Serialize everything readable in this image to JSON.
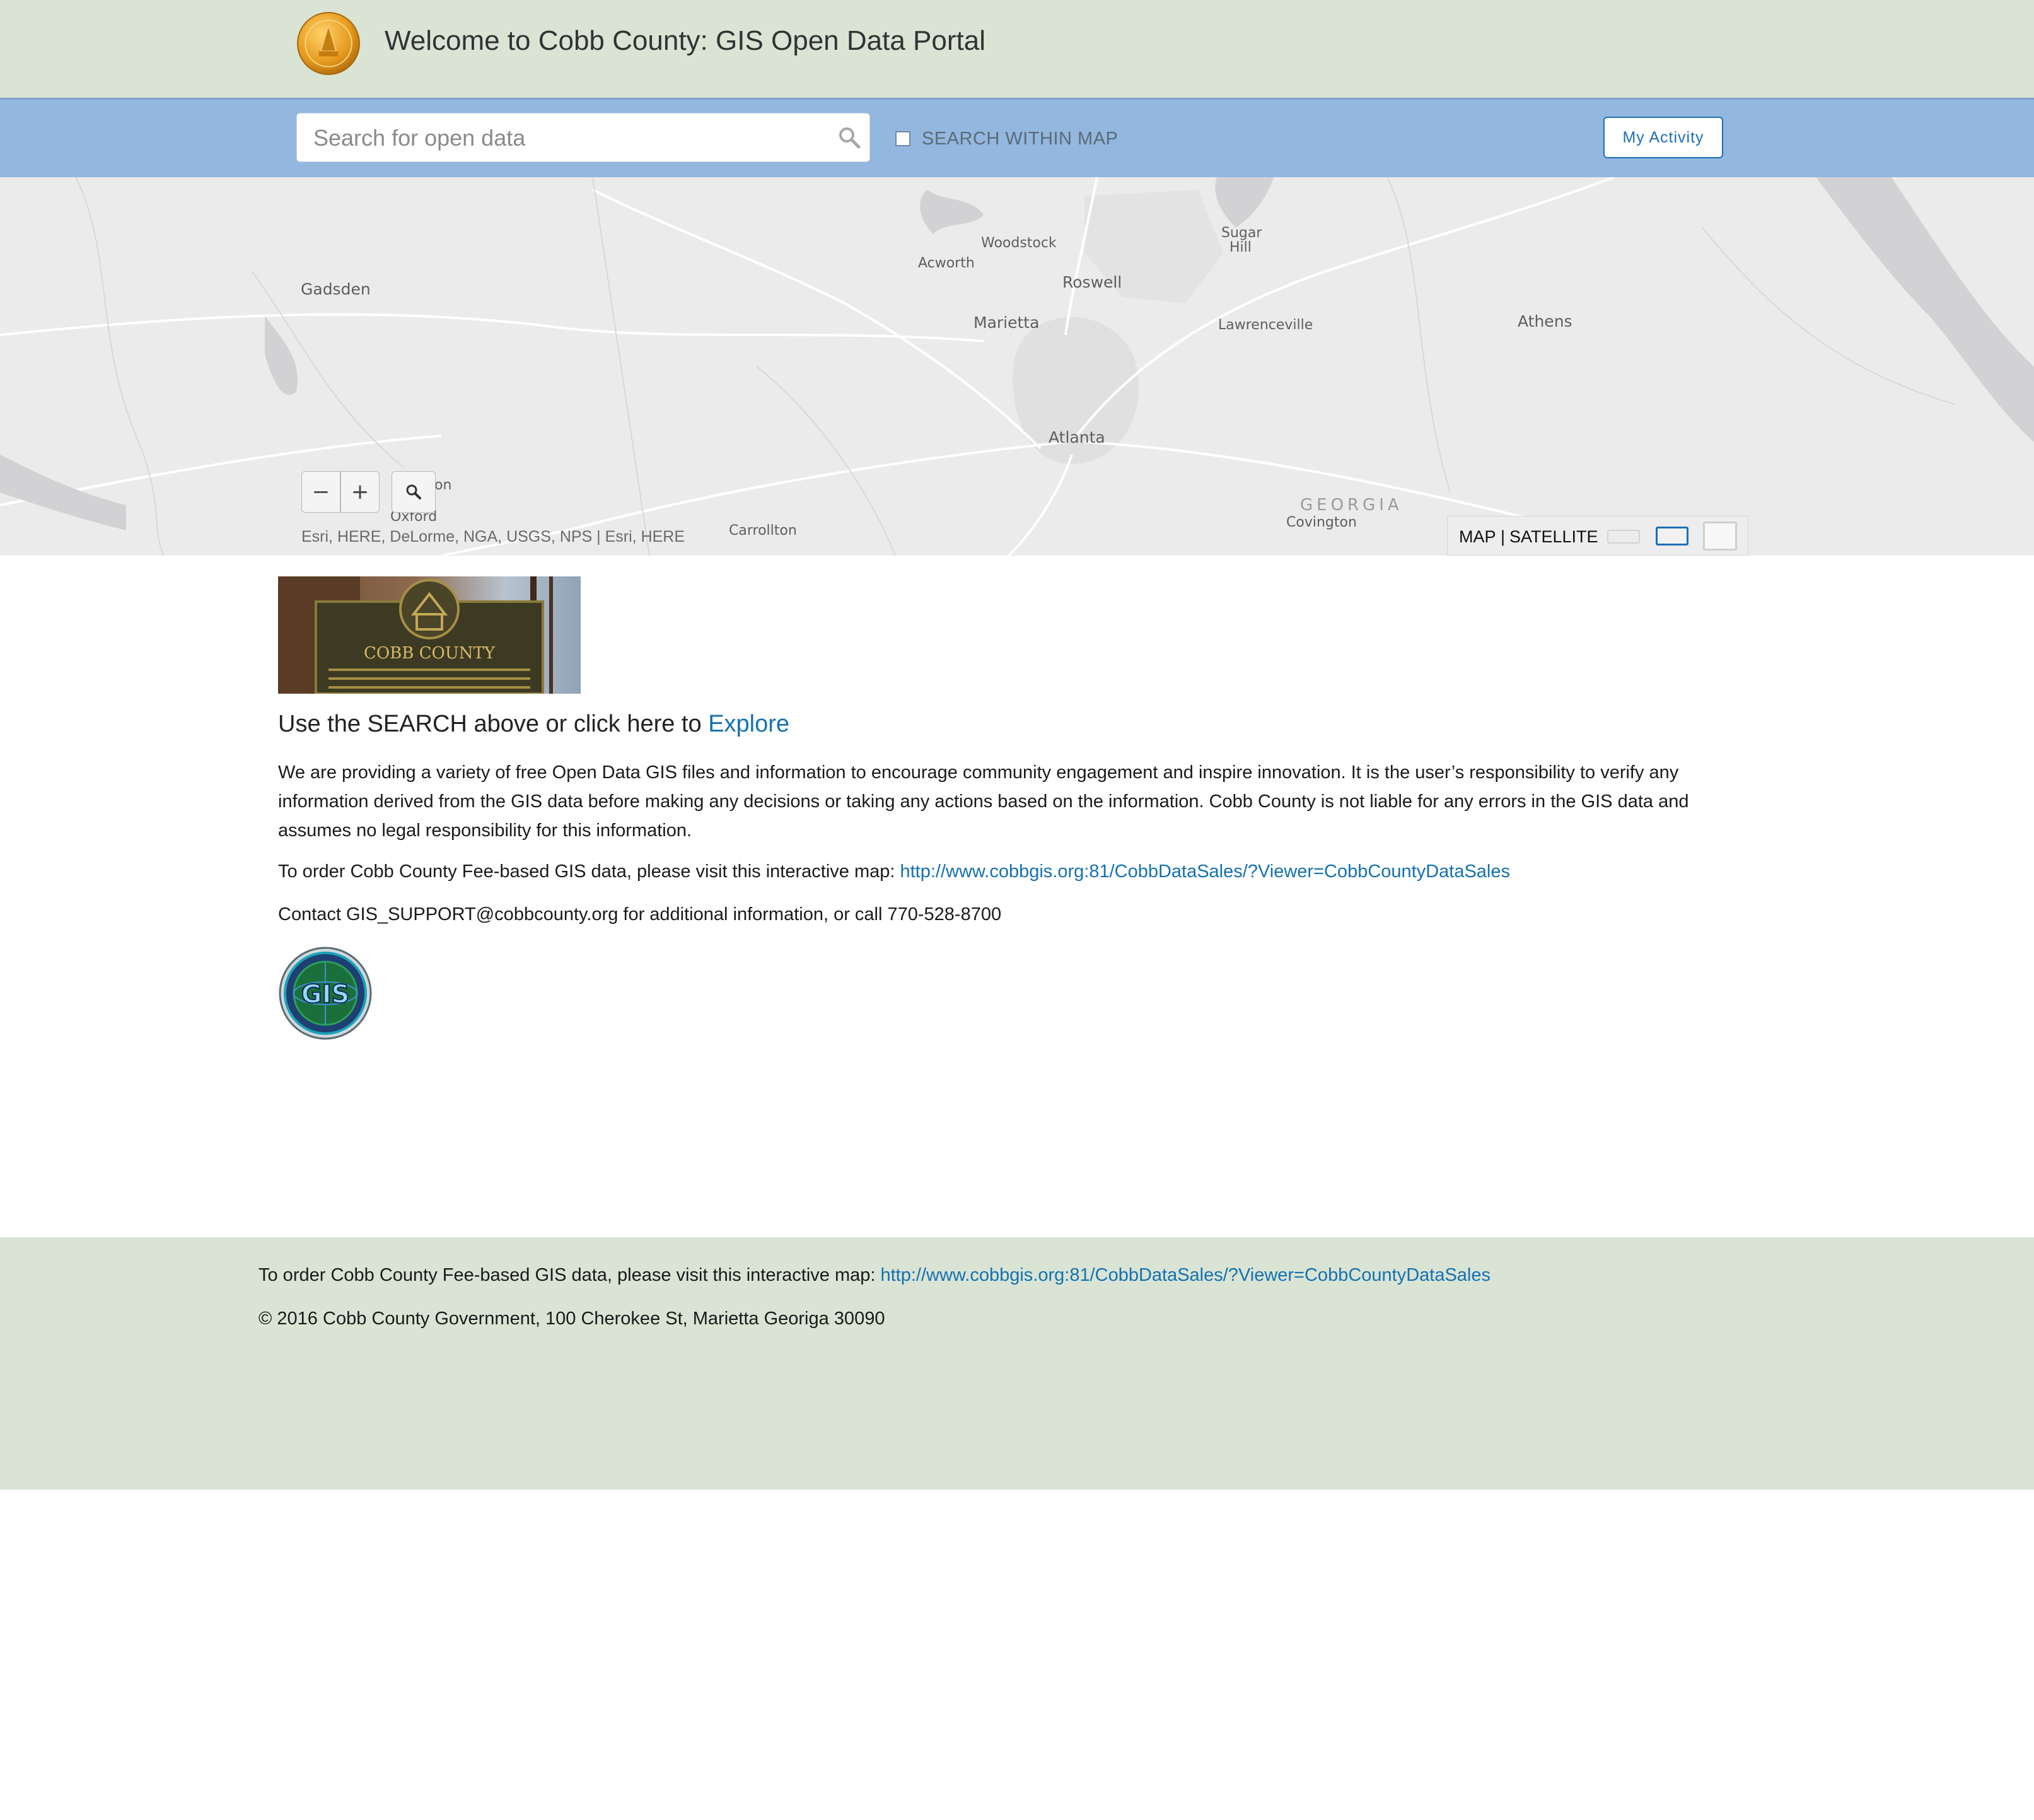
{
  "header": {
    "title": "Welcome to Cobb County: GIS Open Data Portal",
    "seal_icon": "county-seal-icon"
  },
  "search": {
    "placeholder": "Search for open data",
    "value": "",
    "within_map_label": "SEARCH WITHIN MAP",
    "within_map_checked": false
  },
  "toolbar": {
    "my_activity_label": "My Activity"
  },
  "map": {
    "places": {
      "gadsden": "Gadsden",
      "woodstock": "Woodstock",
      "acworth": "Acworth",
      "sugar_hill_1": "Sugar",
      "sugar_hill_2": "Hill",
      "roswell": "Roswell",
      "marietta": "Marietta",
      "lawrenceville": "Lawrenceville",
      "athens": "Athens",
      "atlanta": "Atlanta",
      "oxford": "Oxford",
      "anniston_partial": "on",
      "carrollton": "Carrollton",
      "georgia": "GEORGIA",
      "covington": "Covington"
    },
    "zoom_out_label": "−",
    "zoom_in_label": "+",
    "attribution": "Esri, HERE, DeLorme, NGA, USGS, NPS |  Esri, HERE",
    "basemap": {
      "map_label": "MAP",
      "separator": "|",
      "satellite_label": "SATELLITE"
    }
  },
  "content": {
    "banner_sign_text": "COBB COUNTY",
    "lead_text": "Use the SEARCH above or click here to ",
    "explore_link": "Explore",
    "paragraph": "We are providing a variety of free Open Data GIS files and information to encourage community engagement and inspire innovation. It is the user’s responsibility to verify any information derived from the GIS data before making any decisions or taking any actions based on the information. Cobb County is not liable for any errors in the GIS data and assumes no legal responsibility for this information.",
    "order_text": "To order Cobb County Fee-based GIS data, please visit this interactive map: ",
    "order_link": "http://www.cobbgis.org:81/CobbDataSales/?Viewer=CobbCountyDataSales",
    "contact_text": "Contact GIS_SUPPORT@cobbcounty.org for additional information, or call 770-528-8700",
    "gis_logo_text": "GIS"
  },
  "footer": {
    "order_text": "To order Cobb County Fee-based GIS data, please visit this interactive map: ",
    "order_link": "http://www.cobbgis.org:81/CobbDataSales/?Viewer=CobbCountyDataSales",
    "copyright": "© 2016 Cobb County Government, 100 Cherokee St, Marietta Georiga 30090"
  },
  "colors": {
    "header_bg": "#d9e4d5",
    "search_band_bg": "#93b7de",
    "link": "#1571b0",
    "accent_button": "#1e6fb5"
  }
}
